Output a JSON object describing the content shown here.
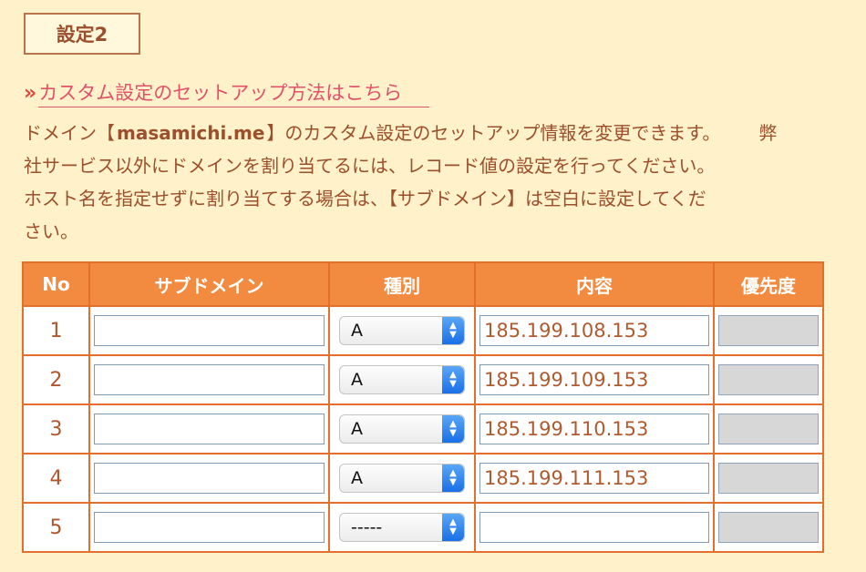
{
  "section": {
    "badge": "設定2"
  },
  "help_link": {
    "arrow": "»",
    "text": "カスタム設定のセットアップ方法はこちら"
  },
  "description": {
    "line1_prefix": "ドメイン【",
    "domain": "masamichi.me",
    "line1_suffix": "】のカスタム設定のセットアップ情報を変更できます。",
    "line1_tail": "弊",
    "line2": "社サービス以外にドメインを割り当てるには、レコード値の設定を行ってください。",
    "line3": "ホスト名を指定せずに割り当てする場合は、【サブドメイン】は空白に設定してくだ",
    "line4": "さい。"
  },
  "table": {
    "headers": {
      "no": "No",
      "subdomain": "サブドメイン",
      "type": "種別",
      "content": "内容",
      "priority": "優先度"
    },
    "rows": [
      {
        "no": "1",
        "subdomain": "",
        "type": "A",
        "content": "185.199.108.153",
        "priority": ""
      },
      {
        "no": "2",
        "subdomain": "",
        "type": "A",
        "content": "185.199.109.153",
        "priority": ""
      },
      {
        "no": "3",
        "subdomain": "",
        "type": "A",
        "content": "185.199.110.153",
        "priority": ""
      },
      {
        "no": "4",
        "subdomain": "",
        "type": "A",
        "content": "185.199.111.153",
        "priority": ""
      },
      {
        "no": "5",
        "subdomain": "",
        "type": "-----",
        "content": "",
        "priority": ""
      }
    ]
  },
  "colors": {
    "background": "#fff1c9",
    "header": "#f28a3f",
    "border": "#e46e2b",
    "link": "#e0526a",
    "text": "#9c4f2c"
  }
}
